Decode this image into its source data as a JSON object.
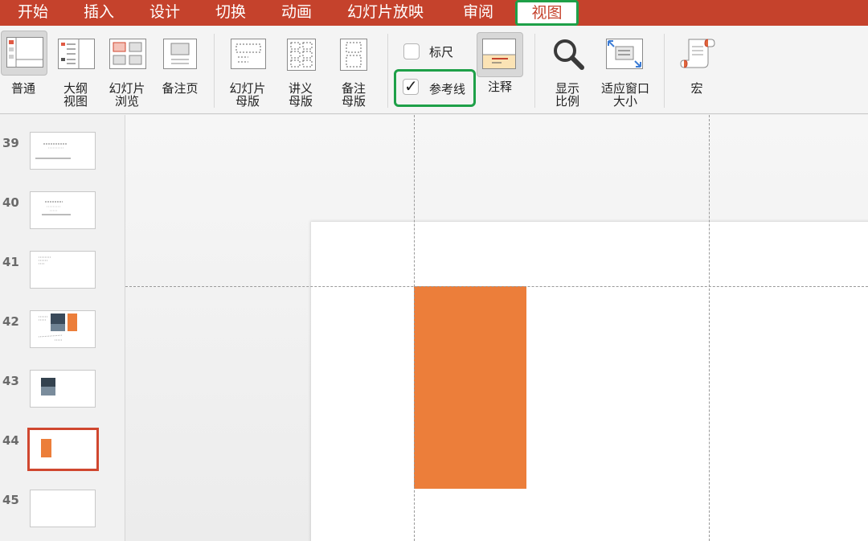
{
  "menu": {
    "items": [
      "开始",
      "插入",
      "设计",
      "切换",
      "动画",
      "幻灯片放映",
      "审阅",
      "视图"
    ],
    "active_index": 7
  },
  "ribbon": {
    "normal": "普通",
    "outline": [
      "大纲",
      "视图"
    ],
    "sorter": [
      "幻灯片",
      "浏览"
    ],
    "notes_page": "备注页",
    "slide_master": [
      "幻灯片",
      "母版"
    ],
    "handout_master": [
      "讲义",
      "母版"
    ],
    "notes_master": [
      "备注",
      "母版"
    ],
    "ruler": "标尺",
    "ruler_checked": false,
    "guides": "参考线",
    "guides_checked": true,
    "notes": "注释",
    "zoom": [
      "显示",
      "比例"
    ],
    "fit": [
      "适应窗口",
      "大小"
    ],
    "macros": "宏"
  },
  "thumbnails": [
    {
      "number": "39",
      "selected": false
    },
    {
      "number": "40",
      "selected": false
    },
    {
      "number": "41",
      "selected": false
    },
    {
      "number": "42",
      "selected": false
    },
    {
      "number": "43",
      "selected": false
    },
    {
      "number": "44",
      "selected": true
    },
    {
      "number": "45",
      "selected": false
    }
  ],
  "colors": {
    "accent": "#c5422c",
    "highlight": "#1ea048",
    "shape": "#ec7e3a",
    "selection": "#d0472f"
  },
  "icons": {
    "checkmark": "✓"
  }
}
